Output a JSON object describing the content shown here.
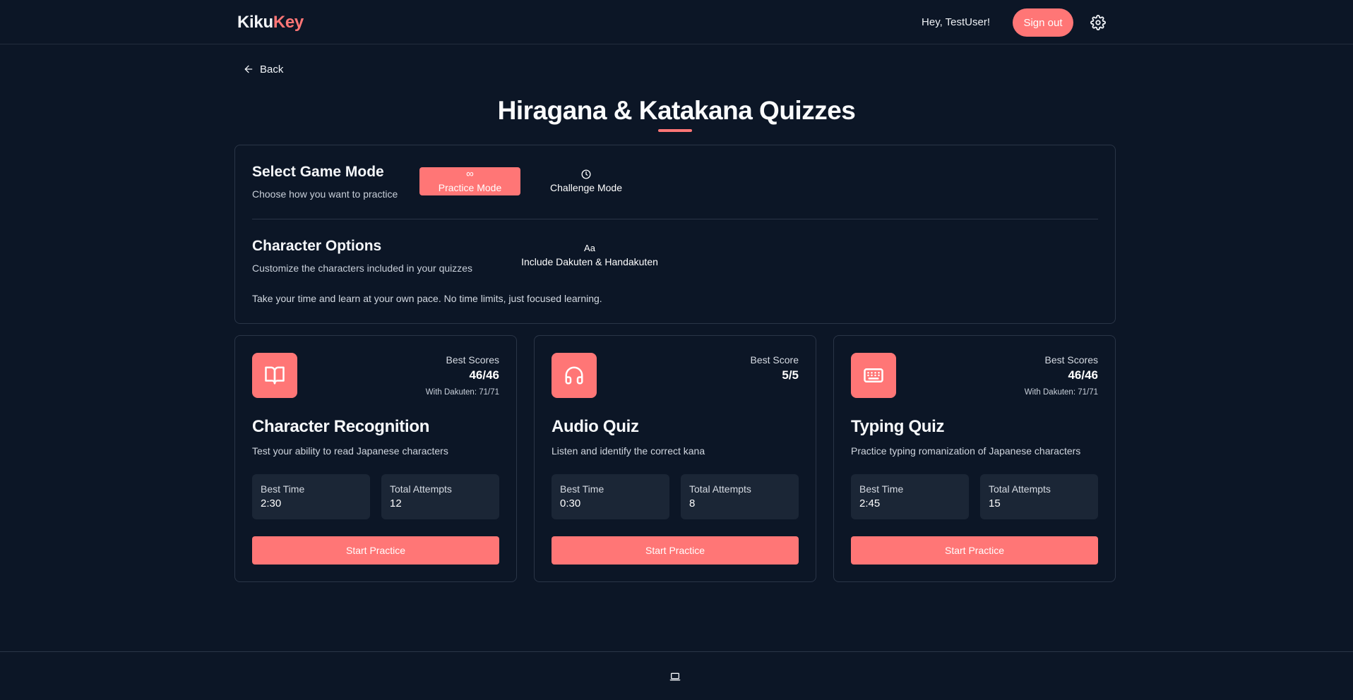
{
  "header": {
    "logo_part1": "Kiku",
    "logo_part2": "Key",
    "greeting": "Hey, TestUser!",
    "signout_label": "Sign out",
    "settings_icon": "gear-icon"
  },
  "nav": {
    "back_label": "Back"
  },
  "page": {
    "title": "Hiragana & Katakana Quizzes"
  },
  "game_mode": {
    "title": "Select Game Mode",
    "subtitle": "Choose how you want to practice",
    "modes": [
      {
        "label": "Practice Mode",
        "icon": "∞",
        "active": true
      },
      {
        "label": "Challenge Mode",
        "icon": "clock-icon",
        "active": false
      }
    ]
  },
  "character_options": {
    "title": "Character Options",
    "subtitle": "Customize the characters included in your quizzes",
    "toggle_label": "Include Dakuten & Handakuten",
    "toggle_icon": "Aa"
  },
  "mode_note": "Take your time and learn at your own pace. No time limits, just focused learning.",
  "quizzes": [
    {
      "icon": "book-icon",
      "score_label": "Best Scores",
      "score": "46/46",
      "score_extra": "With Dakuten: 71/71",
      "title": "Character Recognition",
      "description": "Test your ability to read Japanese characters",
      "best_time_label": "Best Time",
      "best_time": "2:30",
      "attempts_label": "Total Attempts",
      "attempts": "12",
      "button_label": "Start Practice"
    },
    {
      "icon": "headphones-icon",
      "score_label": "Best Score",
      "score": "5/5",
      "score_extra": "",
      "title": "Audio Quiz",
      "description": "Listen and identify the correct kana",
      "best_time_label": "Best Time",
      "best_time": "0:30",
      "attempts_label": "Total Attempts",
      "attempts": "8",
      "button_label": "Start Practice"
    },
    {
      "icon": "keyboard-icon",
      "score_label": "Best Scores",
      "score": "46/46",
      "score_extra": "With Dakuten: 71/71",
      "title": "Typing Quiz",
      "description": "Practice typing romanization of Japanese characters",
      "best_time_label": "Best Time",
      "best_time": "2:45",
      "attempts_label": "Total Attempts",
      "attempts": "15",
      "button_label": "Start Practice"
    }
  ],
  "footer": {
    "icon": "laptop-icon"
  },
  "colors": {
    "background": "#0c1626",
    "accent": "#ff7676",
    "card_border": "#2a3547",
    "stat_bg": "#1b2636"
  }
}
